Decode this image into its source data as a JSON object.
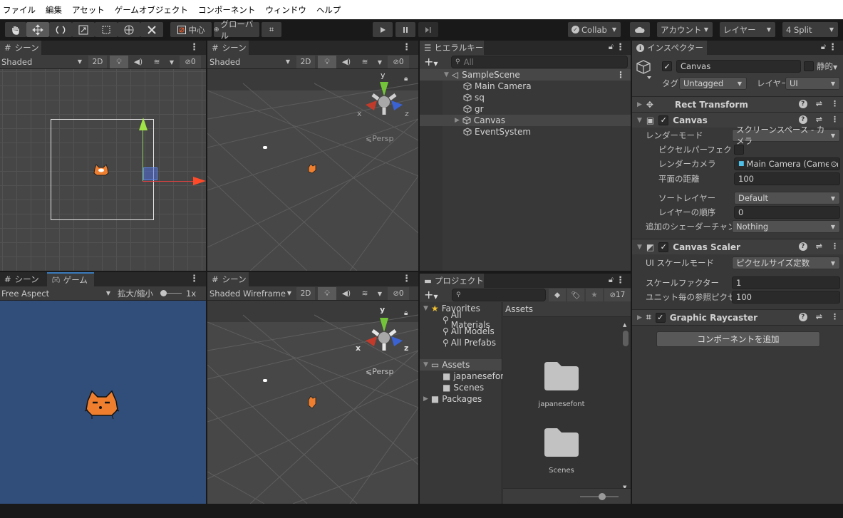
{
  "menu": [
    "ファイル",
    "編集",
    "アセット",
    "ゲームオブジェクト",
    "コンポーネント",
    "ウィンドウ",
    "ヘルプ"
  ],
  "toolbar": {
    "tools": [
      "hand-tool",
      "move-tool",
      "rotate-tool",
      "scale-tool",
      "rect-tool",
      "transform-tool",
      "custom-tool"
    ],
    "pivot_label": "中心",
    "space_label": "グローバル",
    "collab_label": "Collab",
    "account_label": "アカウント",
    "layers_label": "レイヤー",
    "layout_label": "4 Split"
  },
  "scene_tl": {
    "tab": "シーン",
    "shading": "Shaded",
    "btn_2d": "2D",
    "hidden_count": "0"
  },
  "scene_tr": {
    "tab": "シーン",
    "shading": "Shaded",
    "btn_2d": "2D",
    "hidden_count": "0",
    "persp": "Persp"
  },
  "game": {
    "scene_tab": "シーン",
    "game_tab": "ゲーム",
    "aspect": "Free Aspect",
    "scale_label": "拡大/縮小",
    "scale_value": "1x",
    "background": "#314d79"
  },
  "scene_br": {
    "tab": "シーン",
    "shading": "Shaded Wireframe",
    "btn_2d": "2D",
    "hidden_count": "0",
    "persp": "Persp",
    "axis_x": "x",
    "axis_y": "y",
    "axis_z": "z"
  },
  "gizmo_tr": {
    "axis_x": "x",
    "axis_y": "y",
    "axis_z": "z"
  },
  "hierarchy": {
    "tab": "ヒエラルキー",
    "search_placeholder": "All",
    "scene": "SampleScene",
    "items": [
      "Main Camera",
      "sq",
      "gr",
      "Canvas",
      "EventSystem"
    ],
    "selected": "Canvas"
  },
  "project": {
    "tab": "プロジェクト",
    "hidden_count": "17",
    "favorites": "Favorites",
    "fav_items": [
      "All Materials",
      "All Models",
      "All Prefabs"
    ],
    "assets": "Assets",
    "asset_folders": [
      "japanesefont",
      "Scenes"
    ],
    "packages": "Packages",
    "breadcrumb": "Assets",
    "grid_items": [
      "japanesefont",
      "Scenes"
    ],
    "script_glyph": "#"
  },
  "inspector": {
    "tab": "インスペクター",
    "object_name": "Canvas",
    "static_label": "静的",
    "tag_label": "タグ",
    "tag_value": "Untagged",
    "layer_label": "レイヤー",
    "layer_value": "UI",
    "components": {
      "rect_transform": "Rect Transform",
      "canvas": "Canvas",
      "canvas_scaler": "Canvas Scaler",
      "graphic_raycaster": "Graphic Raycaster"
    },
    "canvas_fields": {
      "render_mode_label": "レンダーモード",
      "render_mode_value": "スクリーンスペース - カメラ",
      "pixel_perfect_label": "ピクセルパーフェクト",
      "render_camera_label": "レンダーカメラ",
      "render_camera_value": "Main Camera (Camera)",
      "plane_distance_label": "平面の距離",
      "plane_distance_value": "100",
      "sorting_layer_label": "ソートレイヤー",
      "sorting_layer_value": "Default",
      "order_label": "レイヤーの順序",
      "order_value": "0",
      "shader_channels_label": "追加のシェーダーチャンネル",
      "shader_channels_value": "Nothing"
    },
    "scaler_fields": {
      "scale_mode_label": "UI スケールモード",
      "scale_mode_value": "ピクセルサイズ定数",
      "scale_factor_label": "スケールファクター",
      "scale_factor_value": "1",
      "ref_ppu_label": "ユニット毎の参照ピクセル",
      "ref_ppu_value": "100"
    },
    "add_component": "コンポーネントを追加"
  }
}
